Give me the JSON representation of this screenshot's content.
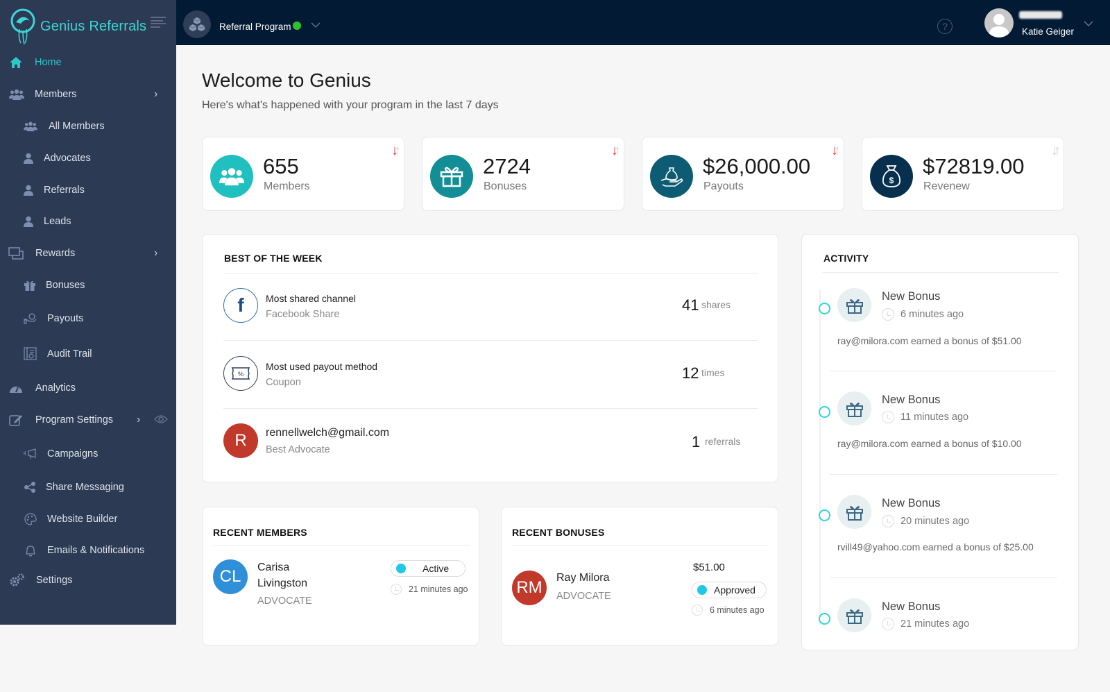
{
  "brand": {
    "name": "Genius Referrals"
  },
  "sidebar": {
    "items": [
      {
        "label": "Home",
        "icon": "home-icon",
        "active": true
      },
      {
        "label": "Members",
        "icon": "users-icon",
        "has_children": true
      },
      {
        "label": "All Members",
        "icon": "users-icon",
        "sub": true
      },
      {
        "label": "Advocates",
        "icon": "user-icon",
        "sub": true
      },
      {
        "label": "Referrals",
        "icon": "user-icon",
        "sub": true
      },
      {
        "label": "Leads",
        "icon": "user-icon",
        "sub": true
      },
      {
        "label": "Rewards",
        "icon": "rewards-icon",
        "has_children": true
      },
      {
        "label": "Bonuses",
        "icon": "gift-icon",
        "sub": true
      },
      {
        "label": "Payouts",
        "icon": "payout-icon",
        "sub": true
      },
      {
        "label": "Audit Trail",
        "icon": "audit-icon",
        "sub": true
      },
      {
        "label": "Analytics",
        "icon": "dashboard-icon"
      },
      {
        "label": "Program Settings",
        "icon": "edit-icon",
        "has_children": true
      },
      {
        "label": "Campaigns",
        "icon": "megaphone-icon",
        "sub": true
      },
      {
        "label": "Share Messaging",
        "icon": "share-icon",
        "sub": true
      },
      {
        "label": "Website Builder",
        "icon": "palette-icon",
        "sub": true
      },
      {
        "label": "Emails & Notifications",
        "icon": "bell-icon",
        "sub": true
      },
      {
        "label": "Settings",
        "icon": "gears-icon"
      }
    ]
  },
  "topbar": {
    "program_name": "Referral Program",
    "program_status_color": "#2bc42b",
    "help_label": "?",
    "user_name": "Katie Geiger"
  },
  "header": {
    "title": "Welcome to Genius",
    "subtitle": "Here's what's happened with your program in the last 7 days"
  },
  "stats": [
    {
      "value": "655",
      "label": "Members",
      "color": "#21c0c0",
      "icon": "users-icon",
      "trend": "down"
    },
    {
      "value": "2724",
      "label": "Bonuses",
      "color": "#138d96",
      "icon": "gift-icon",
      "trend": "down"
    },
    {
      "value": "$26,000.00",
      "label": "Payouts",
      "color": "#0d5c73",
      "icon": "payout-hand-icon",
      "trend": "down"
    },
    {
      "value": "$72819.00",
      "label": "Revenew",
      "color": "#06304e",
      "icon": "money-bag-icon",
      "trend": "none"
    }
  ],
  "best_of_week": {
    "title": "BEST OF THE WEEK",
    "rows": [
      {
        "title": "Most shared channel",
        "subtitle": "Facebook Share",
        "value": "41",
        "unit": "shares",
        "icon": "facebook-icon"
      },
      {
        "title": "Most used payout method",
        "subtitle": "Coupon",
        "value": "12",
        "unit": "times",
        "icon": "coupon-icon"
      },
      {
        "title": "rennellwelch@gmail.com",
        "subtitle": "Best Advocate",
        "value": "1",
        "unit": "referrals",
        "avatar": "R"
      }
    ]
  },
  "activity": {
    "title": "ACTIVITY",
    "items": [
      {
        "title": "New Bonus",
        "time": "6 minutes ago",
        "desc": "ray@milora.com earned a bonus of $51.00"
      },
      {
        "title": "New Bonus",
        "time": "11 minutes ago",
        "desc": "ray@milora.com earned a bonus of $10.00"
      },
      {
        "title": "New Bonus",
        "time": "20 minutes ago",
        "desc": "rvill49@yahoo.com earned a bonus of $25.00"
      },
      {
        "title": "New Bonus",
        "time": "21 minutes ago",
        "desc": ""
      }
    ]
  },
  "recent_members": {
    "title": "RECENT MEMBERS",
    "items": [
      {
        "initials": "CL",
        "first": "Carisa",
        "last": "Livingston",
        "role": "ADVOCATE",
        "status": "Active",
        "time": "21 minutes ago"
      }
    ]
  },
  "recent_bonuses": {
    "title": "RECENT BONUSES",
    "items": [
      {
        "initials": "RM",
        "name": "Ray Milora",
        "role": "ADVOCATE",
        "amount": "$51.00",
        "status": "Approved",
        "time": "6 minutes ago"
      }
    ]
  }
}
